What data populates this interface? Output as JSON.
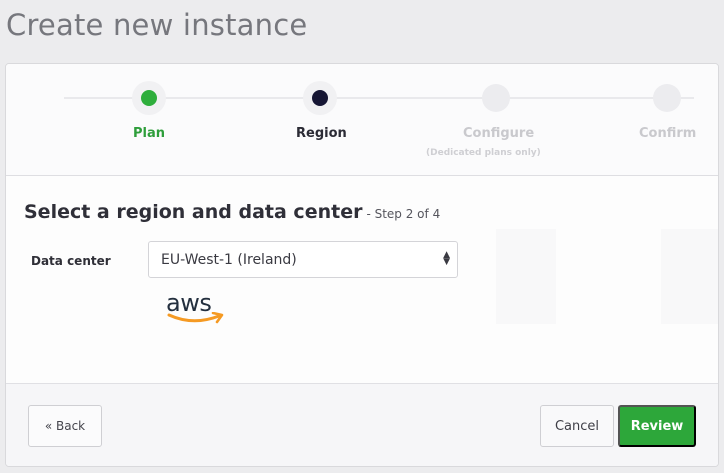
{
  "page": {
    "title": "Create new instance"
  },
  "stepper": {
    "steps": [
      {
        "label": "Plan",
        "state": "complete"
      },
      {
        "label": "Region",
        "state": "current"
      },
      {
        "label": "Configure",
        "sublabel": "(Dedicated plans only)",
        "state": "disabled"
      },
      {
        "label": "Confirm",
        "state": "disabled"
      }
    ]
  },
  "region": {
    "heading": "Select a region and data center",
    "step_note": "- Step 2 of 4",
    "data_center_label": "Data center",
    "data_center_value": "EU-West-1 (Ireland)",
    "provider_logo_text": "aws"
  },
  "footer": {
    "back_label": "« Back",
    "cancel_label": "Cancel",
    "review_label": "Review"
  },
  "colors": {
    "accent_green": "#2da73a",
    "current_step": "#161634"
  }
}
